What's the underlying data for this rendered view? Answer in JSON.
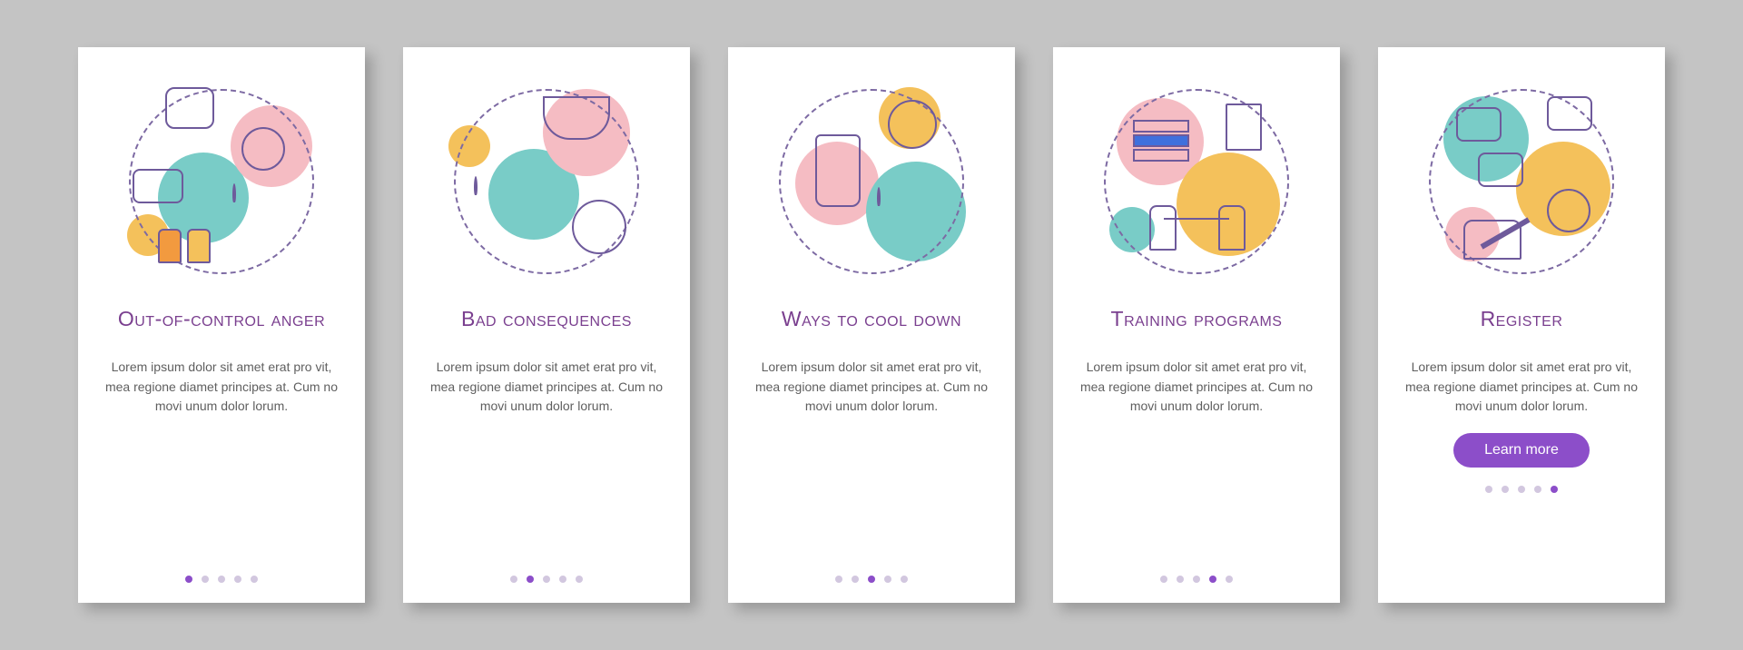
{
  "lorem": "Lorem ipsum dolor sit amet erat pro vit, mea regione diamet principes at. Cum no movi unum dolor lorum.",
  "learn_more": "Learn more",
  "dot_count": 5,
  "cards": [
    {
      "title": "Out-of-control anger",
      "active_dot": 0
    },
    {
      "title": "Bad consequences",
      "active_dot": 1
    },
    {
      "title": "Ways to cool down",
      "active_dot": 2
    },
    {
      "title": "Training programs",
      "active_dot": 3
    },
    {
      "title": "Register",
      "active_dot": 4,
      "has_button": true
    }
  ],
  "colors": {
    "accent": "#8c4ec9",
    "title": "#7a3f8f",
    "body": "#5f5f5f",
    "teal": "#79ccc7",
    "pink": "#f5bcc3",
    "yellow": "#f4c15b"
  }
}
